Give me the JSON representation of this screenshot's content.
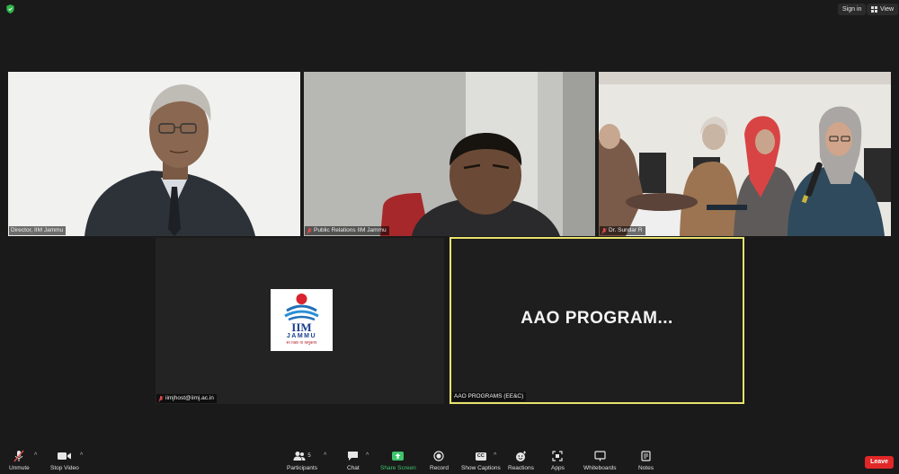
{
  "topbar": {
    "sign_in": "Sign in",
    "view": "View"
  },
  "participants_tiles": [
    {
      "name": "Director, IIM Jammu"
    },
    {
      "name": "Public Relations IIM Jammu"
    },
    {
      "name": "Dr. Sundar R"
    },
    {
      "name": "iimjhost@iimj.ac.in",
      "logo_text": "IIM",
      "logo_subtext": "JAMMU",
      "logo_motto": "सा विद्या या विमुक्तये"
    },
    {
      "name": "AAO PROGRAMS (EE&C)",
      "display_name": "AAO  PROGRAM..."
    }
  ],
  "toolbar": {
    "unmute": "Unmute",
    "stop_video": "Stop Video",
    "participants": "Participants",
    "participants_count": "5",
    "chat": "Chat",
    "share_screen": "Share Screen",
    "record": "Record",
    "show_captions": "Show Captions",
    "captions_icon_text": "CC",
    "reactions": "Reactions",
    "apps": "Apps",
    "whiteboards": "Whiteboards",
    "notes": "Notes",
    "leave": "Leave"
  },
  "colors": {
    "active_speaker": "#e9e36d",
    "share_green": "#3ec46d",
    "leave_red": "#e02828"
  }
}
